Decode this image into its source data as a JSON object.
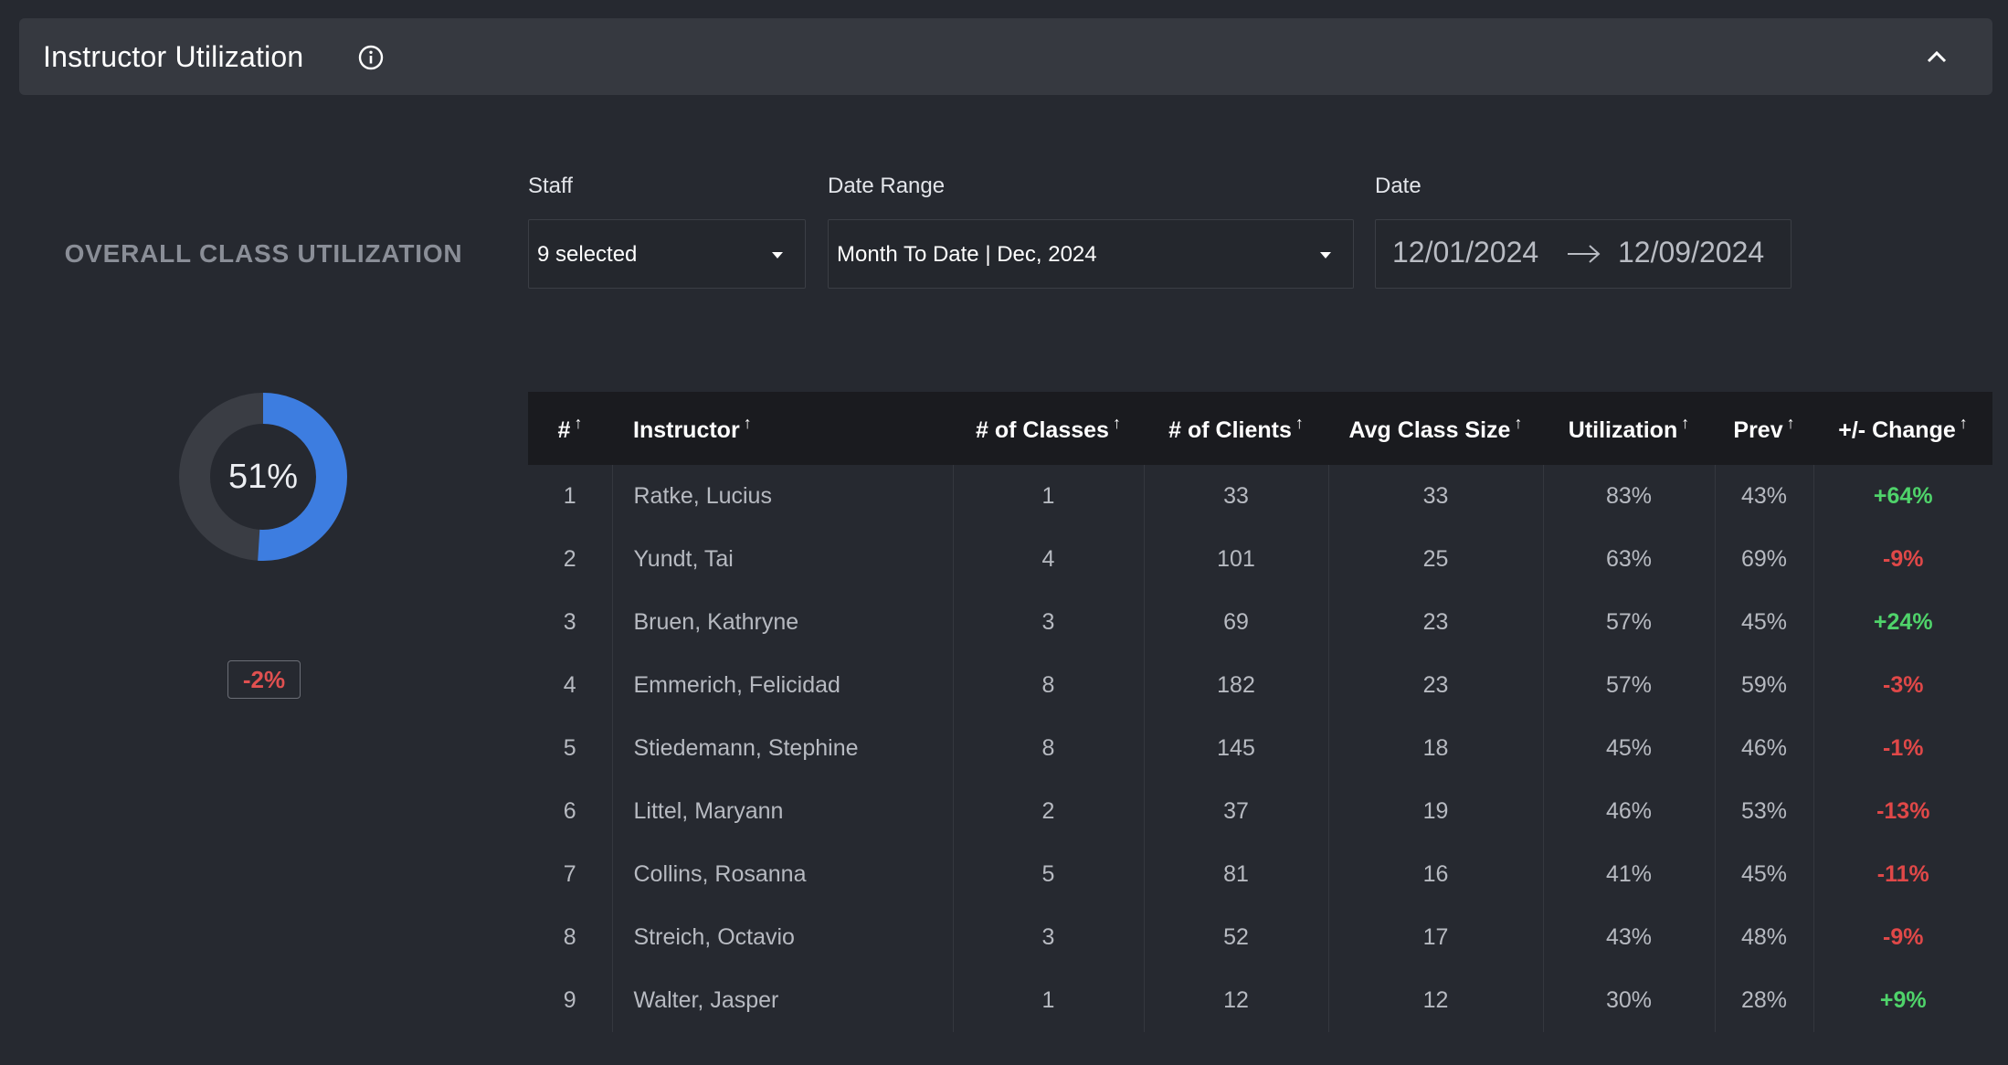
{
  "header": {
    "title": "Instructor Utilization"
  },
  "overall": {
    "title": "OVERALL CLASS UTILIZATION",
    "value_label": "51%",
    "utilization": 0.51,
    "change": "-2%"
  },
  "filters": {
    "staff": {
      "label": "Staff",
      "value": "9 selected"
    },
    "date_range": {
      "label": "Date Range",
      "value": "Month To Date | Dec, 2024"
    },
    "date": {
      "label": "Date",
      "start": "12/01/2024",
      "end": "12/09/2024"
    }
  },
  "table": {
    "headers": [
      "#",
      "Instructor",
      "# of Classes",
      "# of Clients",
      "Avg Class Size",
      "Utilization",
      "Prev",
      "+/- Change"
    ],
    "sort_arrow": "↑",
    "rows": [
      [
        "1",
        "Ratke, Lucius",
        "1",
        "33",
        "33",
        "83%",
        "43%",
        "+64%"
      ],
      [
        "2",
        "Yundt, Tai",
        "4",
        "101",
        "25",
        "63%",
        "69%",
        "-9%"
      ],
      [
        "3",
        "Bruen, Kathryne",
        "3",
        "69",
        "23",
        "57%",
        "45%",
        "+24%"
      ],
      [
        "4",
        "Emmerich, Felicidad",
        "8",
        "182",
        "23",
        "57%",
        "59%",
        "-3%"
      ],
      [
        "5",
        "Stiedemann, Stephine",
        "8",
        "145",
        "18",
        "45%",
        "46%",
        "-1%"
      ],
      [
        "6",
        "Littel, Maryann",
        "2",
        "37",
        "19",
        "46%",
        "53%",
        "-13%"
      ],
      [
        "7",
        "Collins, Rosanna",
        "5",
        "81",
        "16",
        "41%",
        "45%",
        "-11%"
      ],
      [
        "8",
        "Streich, Octavio",
        "3",
        "52",
        "17",
        "43%",
        "48%",
        "-9%"
      ],
      [
        "9",
        "Walter, Jasper",
        "1",
        "12",
        "12",
        "30%",
        "28%",
        "+9%"
      ]
    ]
  },
  "colors": {
    "accent": "#3d7de0",
    "positive": "#4fd36a",
    "negative": "#e04848",
    "donut_track": "#3a3d44"
  },
  "icons": {
    "info": "info-icon",
    "collapse": "chevron-up-icon",
    "arrow": "arrow-right-icon",
    "dropdown": "caret-down-icon",
    "sort": "sort-arrow-icon"
  }
}
